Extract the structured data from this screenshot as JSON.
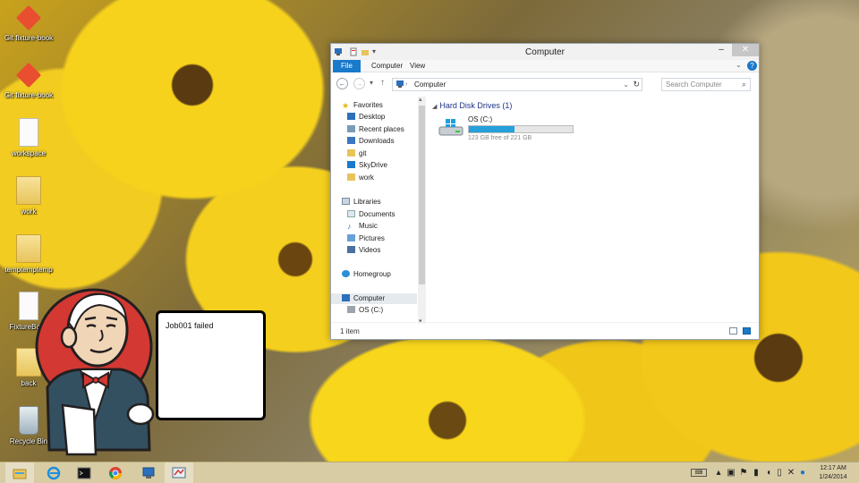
{
  "desktop": {
    "icons": [
      {
        "label": "Git fixture-book",
        "icon": "git-icon"
      },
      {
        "label": "Git fixture-book",
        "icon": "git-icon"
      },
      {
        "label": "workspace",
        "icon": "file-icon"
      },
      {
        "label": "work",
        "icon": "folder-icon"
      },
      {
        "label": "temptemptemp",
        "icon": "folder-icon"
      },
      {
        "label": "FixtureBook",
        "icon": "file-icon"
      },
      {
        "label": "back",
        "icon": "folder-icon"
      },
      {
        "label": "Recycle Bin",
        "icon": "recycle-bin-icon"
      }
    ]
  },
  "notification": {
    "message": "Job001 failed",
    "mascot": "jenkins-butler-icon"
  },
  "explorer": {
    "title": "Computer",
    "ribbon_tabs": [
      "File",
      "Computer",
      "View"
    ],
    "address": "Computer",
    "search_placeholder": "Search Computer",
    "nav": {
      "favorites_header": "Favorites",
      "favorites": [
        "Desktop",
        "Recent places",
        "Downloads",
        "git",
        "SkyDrive",
        "work"
      ],
      "libraries_header": "Libraries",
      "libraries": [
        "Documents",
        "Music",
        "Pictures",
        "Videos"
      ],
      "homegroup": "Homegroup",
      "computer": "Computer",
      "drive": "OS (C:)"
    },
    "group_header": "Hard Disk Drives (1)",
    "drive": {
      "name": "OS (C:)",
      "free_text": "123 GB free of 221 GB",
      "used_fraction": 0.443
    },
    "status": "1 item"
  },
  "taskbar": {
    "apps": [
      "file-explorer-icon",
      "internet-explorer-icon",
      "command-prompt-icon",
      "chrome-icon",
      "computer-icon",
      "jenkins-tray-icon"
    ],
    "clock_time": "12:17 AM",
    "clock_date": "1/24/2014"
  },
  "colors": {
    "accent": "#1979ca",
    "drive_bar": "#26a0da",
    "taskbar": "#d8cca5"
  }
}
